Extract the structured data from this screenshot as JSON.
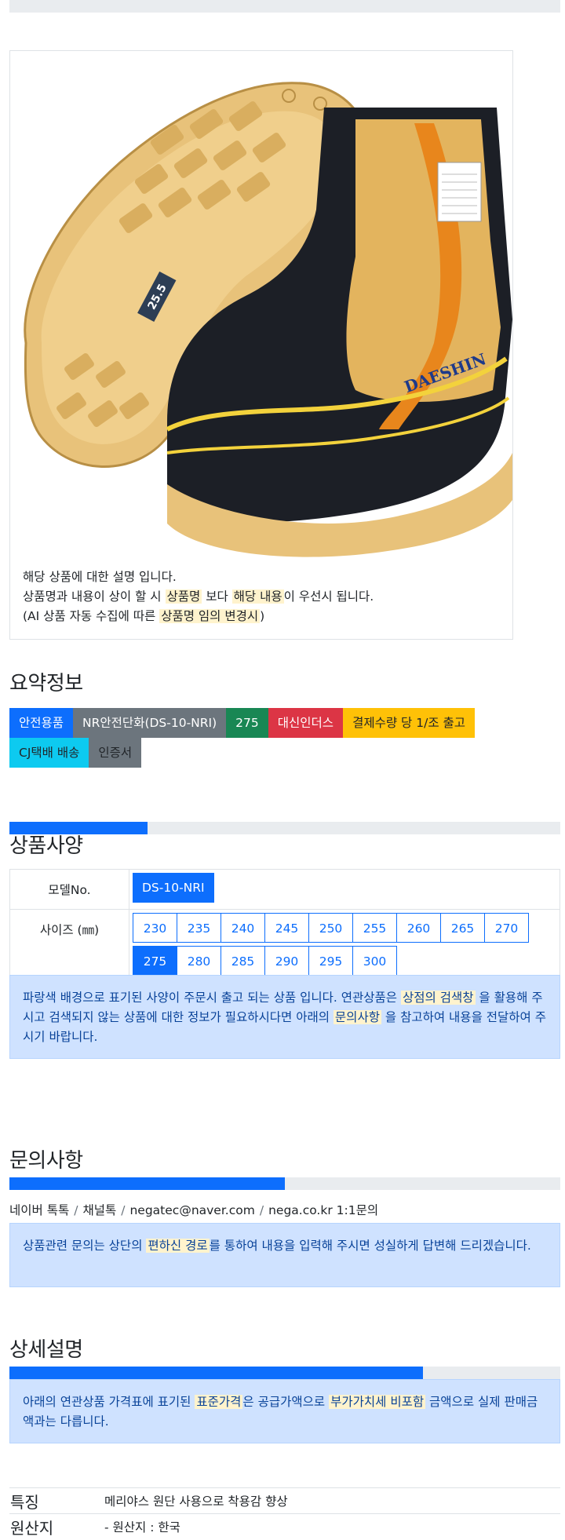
{
  "product": {
    "image_alt": "DAESHIN boot",
    "logo_text": "DAESHIN",
    "sole_size_mark": "25.5",
    "desc_line1": "해당 상품에 대한 설명 입니다.",
    "desc_line2_a": "상품명과 내용이 상이 할 시 ",
    "desc_line2_hl1": "상품명",
    "desc_line2_b": " 보다 ",
    "desc_line2_hl2": "해당 내용",
    "desc_line2_c": "이 우선시 됩니다.",
    "desc_line3_a": "(AI 상품 자동 수집에 따른 ",
    "desc_line3_hl": "상품명 임의 변경시",
    "desc_line3_b": ")"
  },
  "summary": {
    "title": "요약정보",
    "badges": [
      "안전용품",
      "NR안전단화(DS-10-NRI)",
      "275",
      "대신인더스",
      "결제수량 당 1/조 출고",
      "CJ택배 배송",
      "인증서"
    ]
  },
  "spec": {
    "title": "상품사양",
    "progress": 0.25,
    "model_label": "모델No.",
    "model_value": "DS-10-NRI",
    "size_label": "사이즈 (㎜)",
    "sizes": [
      "230",
      "235",
      "240",
      "245",
      "250",
      "255",
      "260",
      "265",
      "270",
      "275",
      "280",
      "285",
      "290",
      "295",
      "300"
    ],
    "selected_size": "275",
    "notice_a": "파랑색 배경으로 표기된 사양이 주문시 출고 되는 상품 입니다. 연관상품은 ",
    "notice_hl1": "상점의 검색창",
    "notice_b": " 을 활용해 주시고 검색되지 않는 상품에 대한 정보가 필요하시다면 아래의 ",
    "notice_hl2": "문의사항",
    "notice_c": " 을 참고하여 내용을 전달하여 주시기 바랍니다."
  },
  "inquiry": {
    "title": "문의사항",
    "progress": 0.5,
    "links": [
      "네이버 톡톡",
      "채널톡",
      "negatec@naver.com",
      "nega.co.kr 1:1문의"
    ],
    "separator": "/",
    "notice_a": "상품관련 문의는 상단의 ",
    "notice_hl": "편하신 경로",
    "notice_b": "를 통하여 내용을 입력해 주시면 성실하게 답변해 드리겠습니다."
  },
  "detail": {
    "title": "상세설명",
    "progress": 0.75,
    "notice_a": "아래의 연관상품 가격표에 표기된 ",
    "notice_hl1": "표준가격",
    "notice_b": "은 공급가액으로 ",
    "notice_hl2": "부가가치세 비포함",
    "notice_c": " 금액으로 실제 판매금액과는 다릅니다.",
    "features": [
      {
        "label": "특징",
        "value": "메리야스 원단 사용으로 착용감 향상"
      },
      {
        "label": "원산지",
        "value": "- 원산지 : 한국"
      }
    ]
  },
  "colors": {
    "primary": "#0d6efd",
    "alert_bg": "#cfe2ff",
    "highlight": "#fff3cd"
  }
}
